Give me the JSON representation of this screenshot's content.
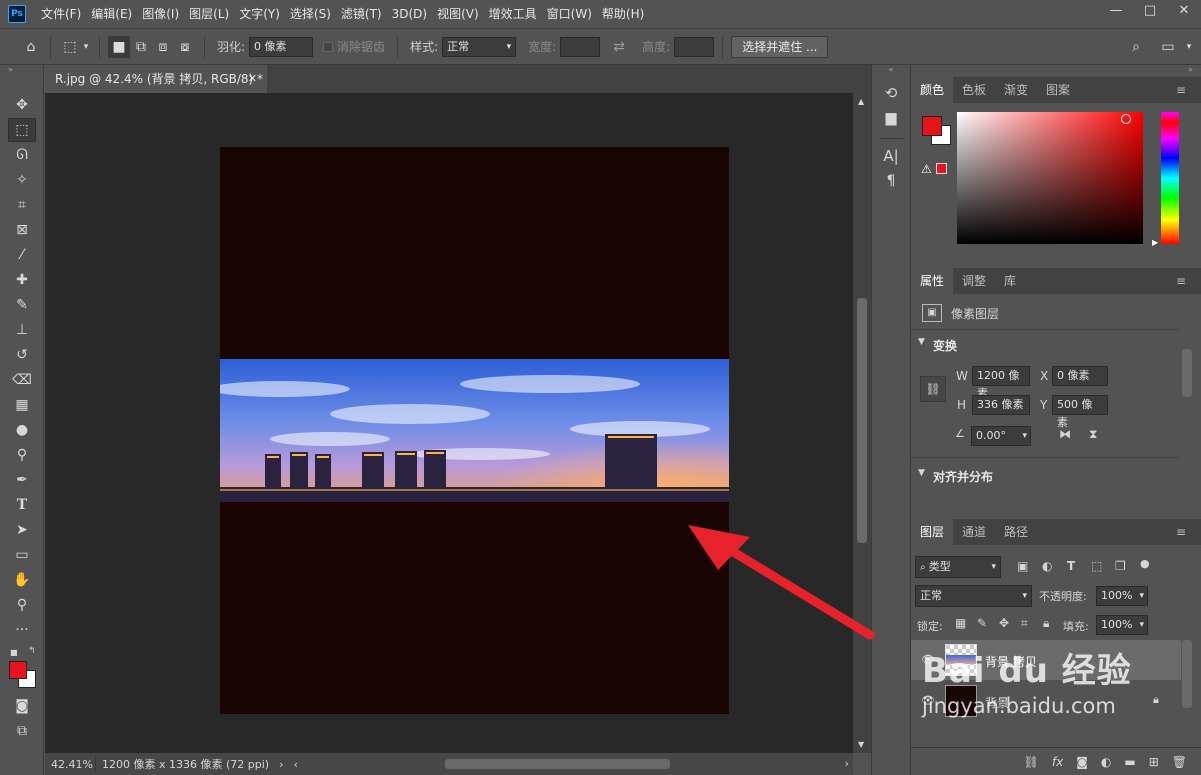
{
  "app": {
    "logo": "Ps"
  },
  "menu": [
    "文件(F)",
    "编辑(E)",
    "图像(I)",
    "图层(L)",
    "文字(Y)",
    "选择(S)",
    "滤镜(T)",
    "3D(D)",
    "视图(V)",
    "增效工具",
    "窗口(W)",
    "帮助(H)"
  ],
  "options": {
    "feather_label": "羽化:",
    "feather_value": "0 像素",
    "antialias_label": "消除锯齿",
    "style_label": "样式:",
    "style_value": "正常",
    "width_label": "宽度:",
    "height_label": "高度:",
    "select_mask_button": "选择并遮住 ..."
  },
  "document": {
    "tab_title": "R.jpg @ 42.4% (背景 拷贝, RGB/8) *"
  },
  "status": {
    "zoom": "42.41%",
    "info": "1200 像素 x 1336 像素 (72 ppi)"
  },
  "color_panel": {
    "tabs": [
      "颜色",
      "色板",
      "渐变",
      "图案"
    ],
    "foreground": "#e8141b",
    "background": "#ffffff"
  },
  "properties_panel": {
    "tabs": [
      "属性",
      "调整",
      "库"
    ],
    "layer_type": "像素图层",
    "transform_title": "变换",
    "w_label": "W",
    "w_value": "1200 像素",
    "h_label": "H",
    "h_value": "336 像素",
    "x_label": "X",
    "x_value": "0 像素",
    "y_label": "Y",
    "y_value": "500 像素",
    "angle_value": "0.00°",
    "align_title": "对齐并分布"
  },
  "layers_panel": {
    "tabs": [
      "图层",
      "通道",
      "路径"
    ],
    "filter_kind": "类型",
    "blend_mode": "正常",
    "opacity_label": "不透明度:",
    "opacity_value": "100%",
    "lock_label": "锁定:",
    "fill_label": "填充:",
    "fill_value": "100%",
    "layers": [
      {
        "name": "背景 拷贝",
        "selected": true
      },
      {
        "name": "背景",
        "selected": false
      }
    ]
  },
  "watermark": {
    "brand": "Bai du 经验",
    "url": "jingyan.baidu.com"
  },
  "colors": {
    "accent_red": "#e8141b",
    "arrow_red": "#e8222b"
  }
}
